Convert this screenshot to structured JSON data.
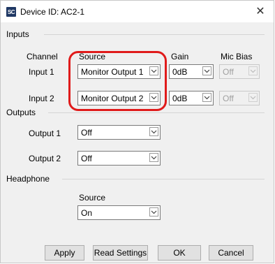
{
  "window": {
    "title": "Device ID: AC2-1",
    "app_icon_text": "SC",
    "close_glyph": "✕"
  },
  "inputs": {
    "section_label": "Inputs",
    "headers": {
      "channel": "Channel",
      "source": "Source",
      "gain": "Gain",
      "mic_bias": "Mic Bias"
    },
    "rows": [
      {
        "channel": "Input 1",
        "source": "Monitor Output 1",
        "gain": "0dB",
        "mic_bias": "Off"
      },
      {
        "channel": "Input 2",
        "source": "Monitor Output 2",
        "gain": "0dB",
        "mic_bias": "Off"
      }
    ]
  },
  "outputs": {
    "section_label": "Outputs",
    "rows": [
      {
        "label": "Output 1",
        "value": "Off"
      },
      {
        "label": "Output 2",
        "value": "Off"
      }
    ]
  },
  "headphone": {
    "section_label": "Headphone",
    "source_label": "Source",
    "source_value": "On"
  },
  "buttons": {
    "apply": "Apply",
    "read_settings": "Read Settings",
    "ok": "OK",
    "cancel": "Cancel"
  },
  "colors": {
    "highlight": "#e01b1b",
    "dialog_bg": "#f0f0f0",
    "button_bg": "#e1e1e1"
  },
  "icons": {
    "dropdown": "chevron-down-icon",
    "close": "close-icon",
    "app": "app-logo-icon"
  }
}
